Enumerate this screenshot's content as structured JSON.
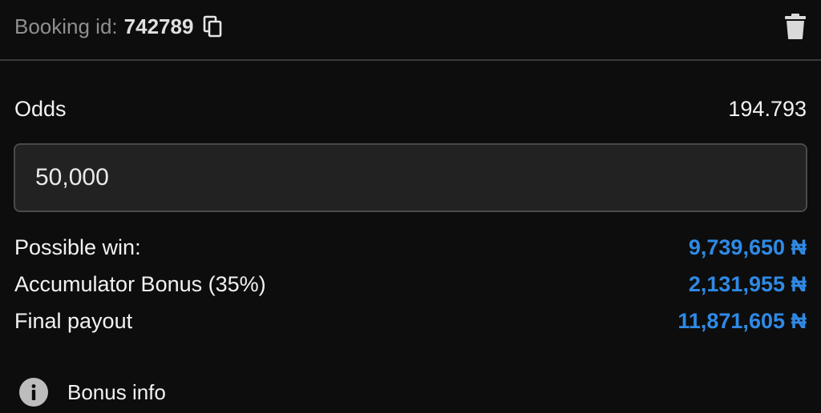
{
  "header": {
    "booking_label": "Booking id:",
    "booking_id": "742789",
    "copy_icon": "copy-icon",
    "delete_icon": "trash-icon"
  },
  "odds": {
    "label": "Odds",
    "value": "194.793"
  },
  "stake": {
    "value": "50,000"
  },
  "summary": {
    "rows": [
      {
        "label": "Possible win:",
        "value": "9,739,650 ₦"
      },
      {
        "label": "Accumulator Bonus (35%)",
        "value": "2,131,955 ₦"
      },
      {
        "label": "Final payout",
        "value": "11,871,605 ₦"
      }
    ],
    "value_color": "#2f8ae5"
  },
  "bonus_info": {
    "label": "Bonus info",
    "icon": "info-icon"
  }
}
